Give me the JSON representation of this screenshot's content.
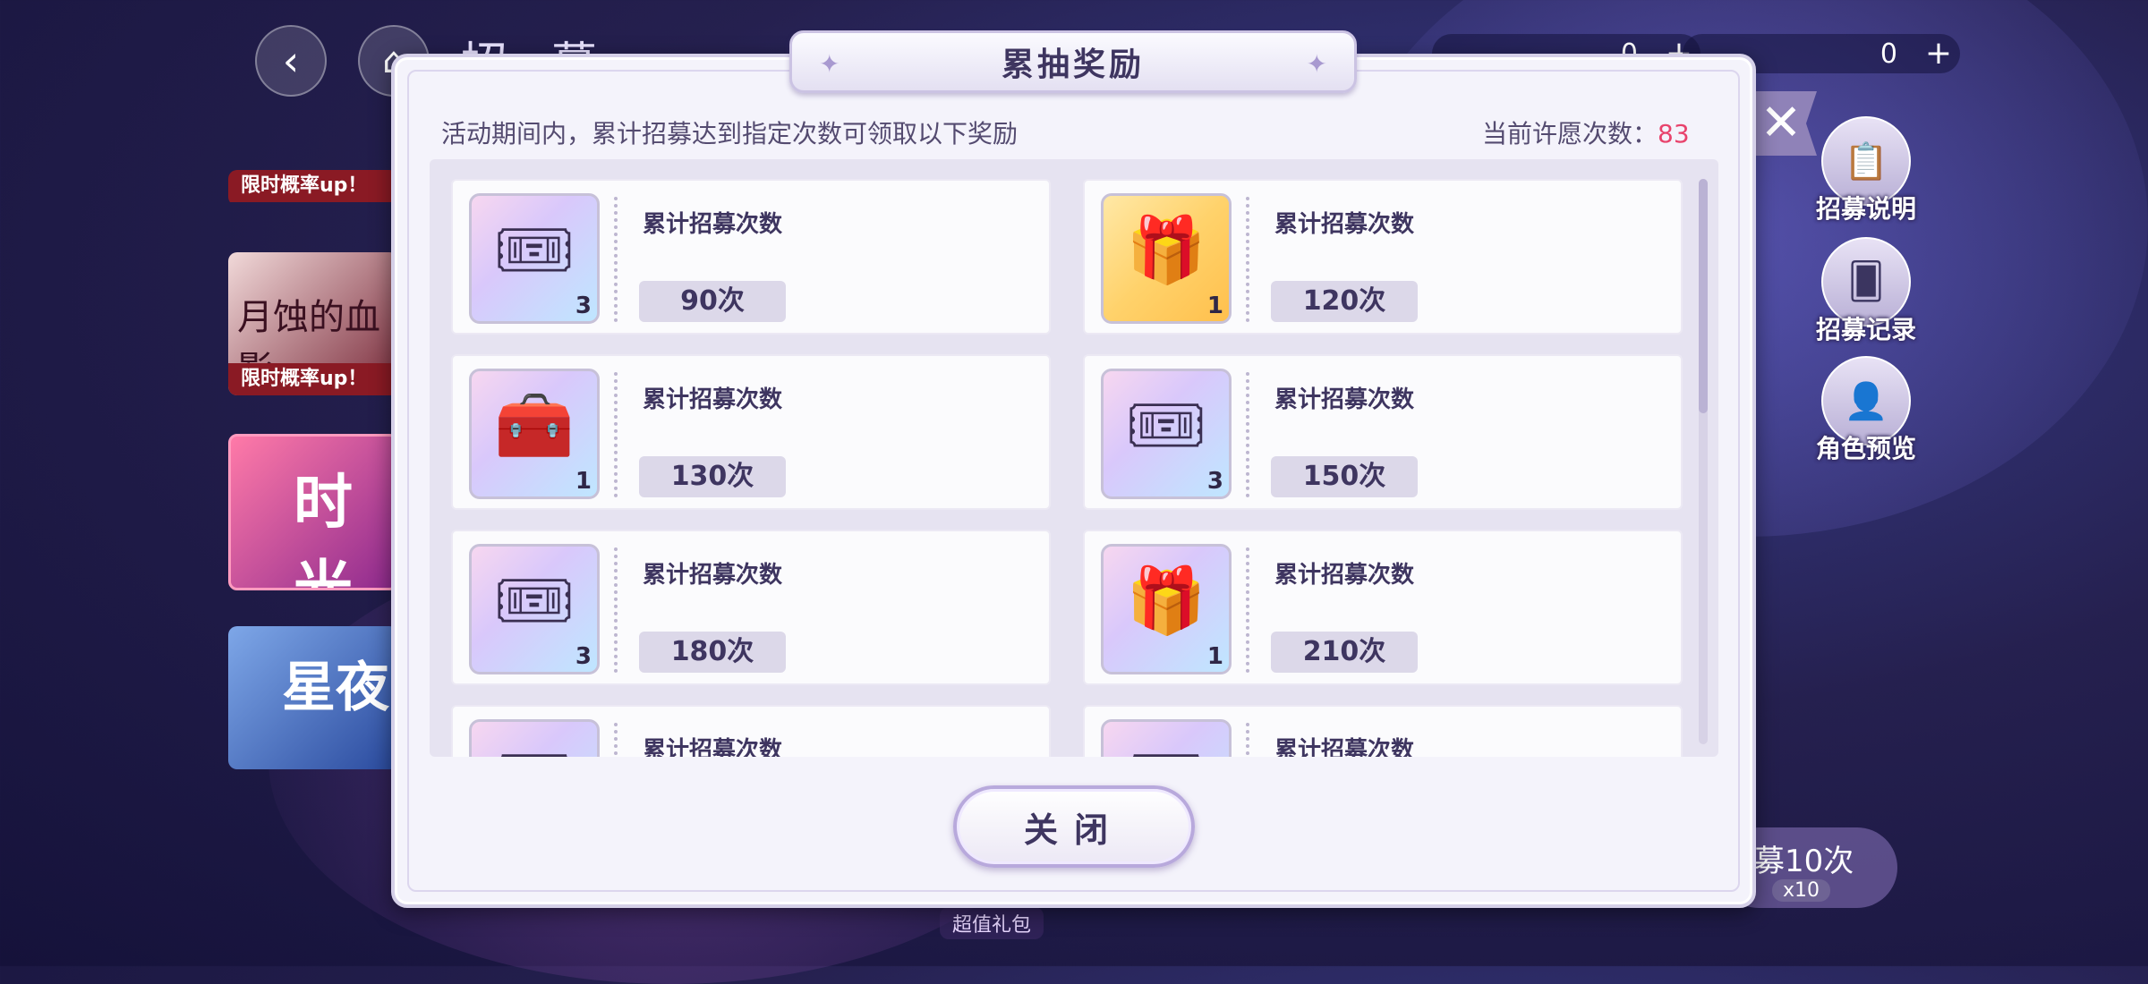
{
  "background": {
    "screen_title": "招 募",
    "currency": [
      {
        "value": "0"
      },
      {
        "value": "0"
      }
    ],
    "banners": [
      {
        "tag": "限时概率up！"
      },
      {
        "title_art": "月蚀的血影",
        "tag": "限时概率up！"
      },
      {
        "title_art": "时光"
      },
      {
        "title_art": "星夜"
      }
    ],
    "side_buttons": [
      {
        "label": "招募说明",
        "icon": "clipboard-icon"
      },
      {
        "label": "招募记录",
        "icon": "cards-icon"
      },
      {
        "label": "角色预览",
        "icon": "person-icon"
      }
    ],
    "recruit_10": {
      "label": "募10次",
      "cost": "x10"
    },
    "gift_tag": "超值礼包"
  },
  "modal": {
    "title": "累抽奖励",
    "description": "活动期间内，累计招募达到指定次数可领取以下奖励",
    "count_label": "当前许愿次数：",
    "count_value": "83",
    "close_button": "关闭",
    "rewards": [
      {
        "label": "累计招募次数",
        "requirement": "90次",
        "quantity": "3",
        "icon": "ticket-icon",
        "style": "purple"
      },
      {
        "label": "累计招募次数",
        "requirement": "120次",
        "quantity": "1",
        "icon": "ssr-gift-box-icon",
        "style": "gold"
      },
      {
        "label": "累计招募次数",
        "requirement": "130次",
        "quantity": "1",
        "icon": "treasure-chest-icon",
        "style": "purple"
      },
      {
        "label": "累计招募次数",
        "requirement": "150次",
        "quantity": "3",
        "icon": "ticket-icon",
        "style": "purple"
      },
      {
        "label": "累计招募次数",
        "requirement": "180次",
        "quantity": "3",
        "icon": "ticket-icon",
        "style": "purple"
      },
      {
        "label": "累计招募次数",
        "requirement": "210次",
        "quantity": "1",
        "icon": "ur-gift-box-icon",
        "style": "purple"
      },
      {
        "label": "累计招募次数",
        "requirement": "",
        "quantity": "",
        "icon": "ticket-icon",
        "style": "purple"
      },
      {
        "label": "累计招募次数",
        "requirement": "",
        "quantity": "",
        "icon": "ticket-icon",
        "style": "purple"
      }
    ]
  },
  "colors": {
    "accent_count": "#e8436c",
    "modal_bg": "#f4f3fb"
  }
}
